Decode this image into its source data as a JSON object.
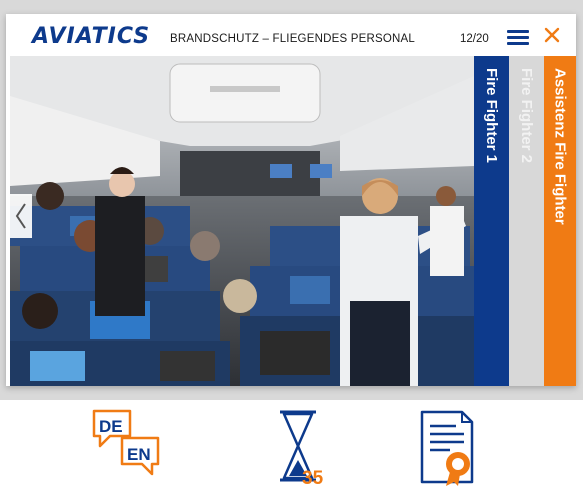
{
  "header": {
    "logo": "AVIATICS",
    "course_title": "BRANDSCHUTZ – FLIEGENDES PERSONAL",
    "page_counter": "12/20"
  },
  "tabs": [
    {
      "label": "Fire Fighter 1",
      "color": "#0d3a8c"
    },
    {
      "label": "Fire Fighter 2",
      "color": "#d8d8d8"
    },
    {
      "label": "Assistenz Fire Fighter",
      "color": "#f07b14"
    }
  ],
  "footer": {
    "language_icon": {
      "top": "DE",
      "bottom": "EN"
    },
    "timer_icon": {
      "value": "35"
    },
    "certificate_icon": "certificate-icon"
  },
  "colors": {
    "brand_blue": "#0d3a8c",
    "accent_orange": "#f07b14"
  }
}
